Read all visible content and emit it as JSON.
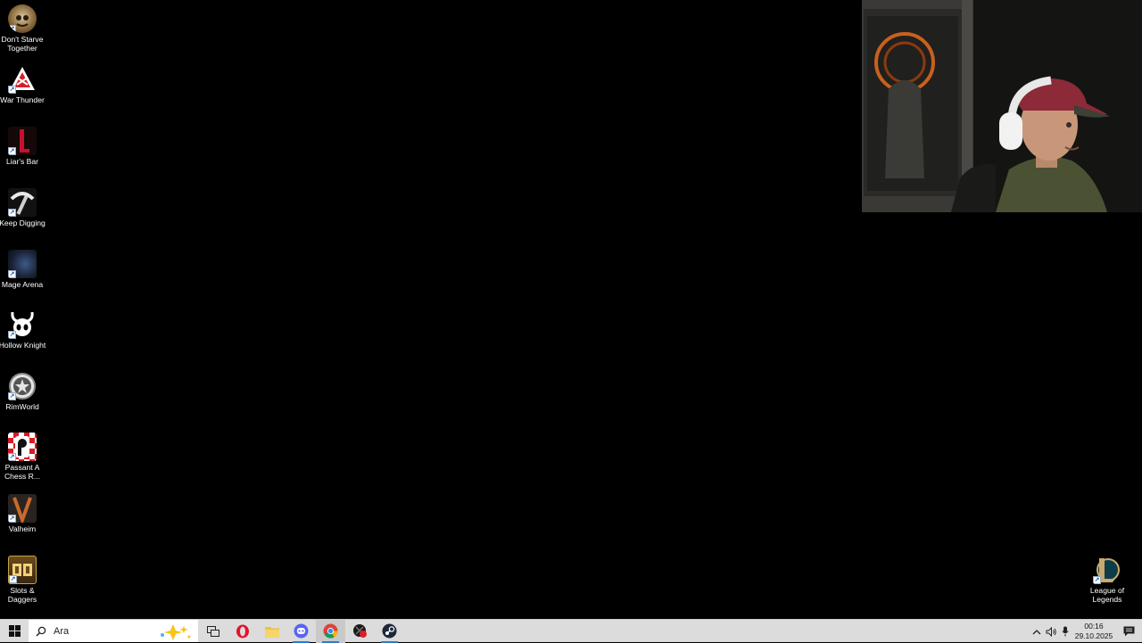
{
  "desktop": {
    "icons": [
      {
        "label": "Don't Starve Together",
        "icon": "dont-starve-together-icon"
      },
      {
        "label": "War Thunder",
        "icon": "war-thunder-icon"
      },
      {
        "label": "Liar's Bar",
        "icon": "liars-bar-icon"
      },
      {
        "label": "Keep Digging",
        "icon": "keep-digging-icon"
      },
      {
        "label": "Mage Arena",
        "icon": "mage-arena-icon"
      },
      {
        "label": "Hollow Knight",
        "icon": "hollow-knight-icon"
      },
      {
        "label": "RimWorld",
        "icon": "rimworld-icon"
      },
      {
        "label": "Passant A Chess R...",
        "icon": "passant-chess-icon"
      },
      {
        "label": "Valheim",
        "icon": "valheim-icon"
      },
      {
        "label": "Slots & Daggers",
        "icon": "slots-daggers-icon"
      }
    ],
    "right_icons": [
      {
        "label": "League of Legends",
        "icon": "league-of-legends-icon"
      }
    ]
  },
  "taskbar": {
    "search_placeholder": "Ara",
    "apps": [
      {
        "name": "task-view",
        "icon": "task-view-icon"
      },
      {
        "name": "opera",
        "icon": "opera-icon"
      },
      {
        "name": "file-explorer",
        "icon": "folder-icon"
      },
      {
        "name": "discord",
        "icon": "discord-icon"
      },
      {
        "name": "chrome",
        "icon": "chrome-icon"
      },
      {
        "name": "app-red-black",
        "icon": "red-black-app-icon"
      },
      {
        "name": "steam",
        "icon": "steam-icon"
      }
    ],
    "clock": {
      "time": "00:16",
      "date": "29.10.2025"
    }
  },
  "colors": {
    "accent": "#2b7cd3",
    "taskbar": "#dcdcdc",
    "desktop": "#000000"
  }
}
